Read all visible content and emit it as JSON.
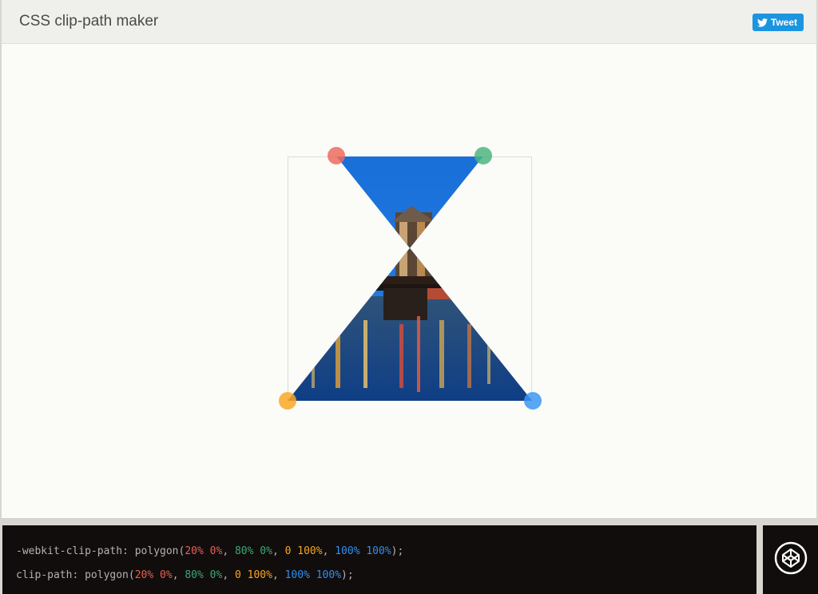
{
  "header": {
    "title": "CSS clip-path maker",
    "tweet_label": "Tweet"
  },
  "icons": {
    "twitter": "twitter-bird-icon",
    "codepen": "codepen-icon"
  },
  "colors": {
    "point1": "#ee6b5e",
    "point2": "#4db57f",
    "point3": "#f9a825",
    "point4": "#3b97f3"
  },
  "code": {
    "line1": {
      "property": "-webkit-clip-path: ",
      "func": "polygon(",
      "p1": "20% 0%",
      "p2": "80% 0%",
      "p3": "0 100%",
      "p4": "100% 100%",
      "sep": ", ",
      "end": ");"
    },
    "line2": {
      "property": "clip-path: ",
      "func": "polygon(",
      "p1": "20% 0%",
      "p2": "80% 0%",
      "p3": "0 100%",
      "p4": "100% 100%",
      "sep": ", ",
      "end": ");"
    }
  }
}
